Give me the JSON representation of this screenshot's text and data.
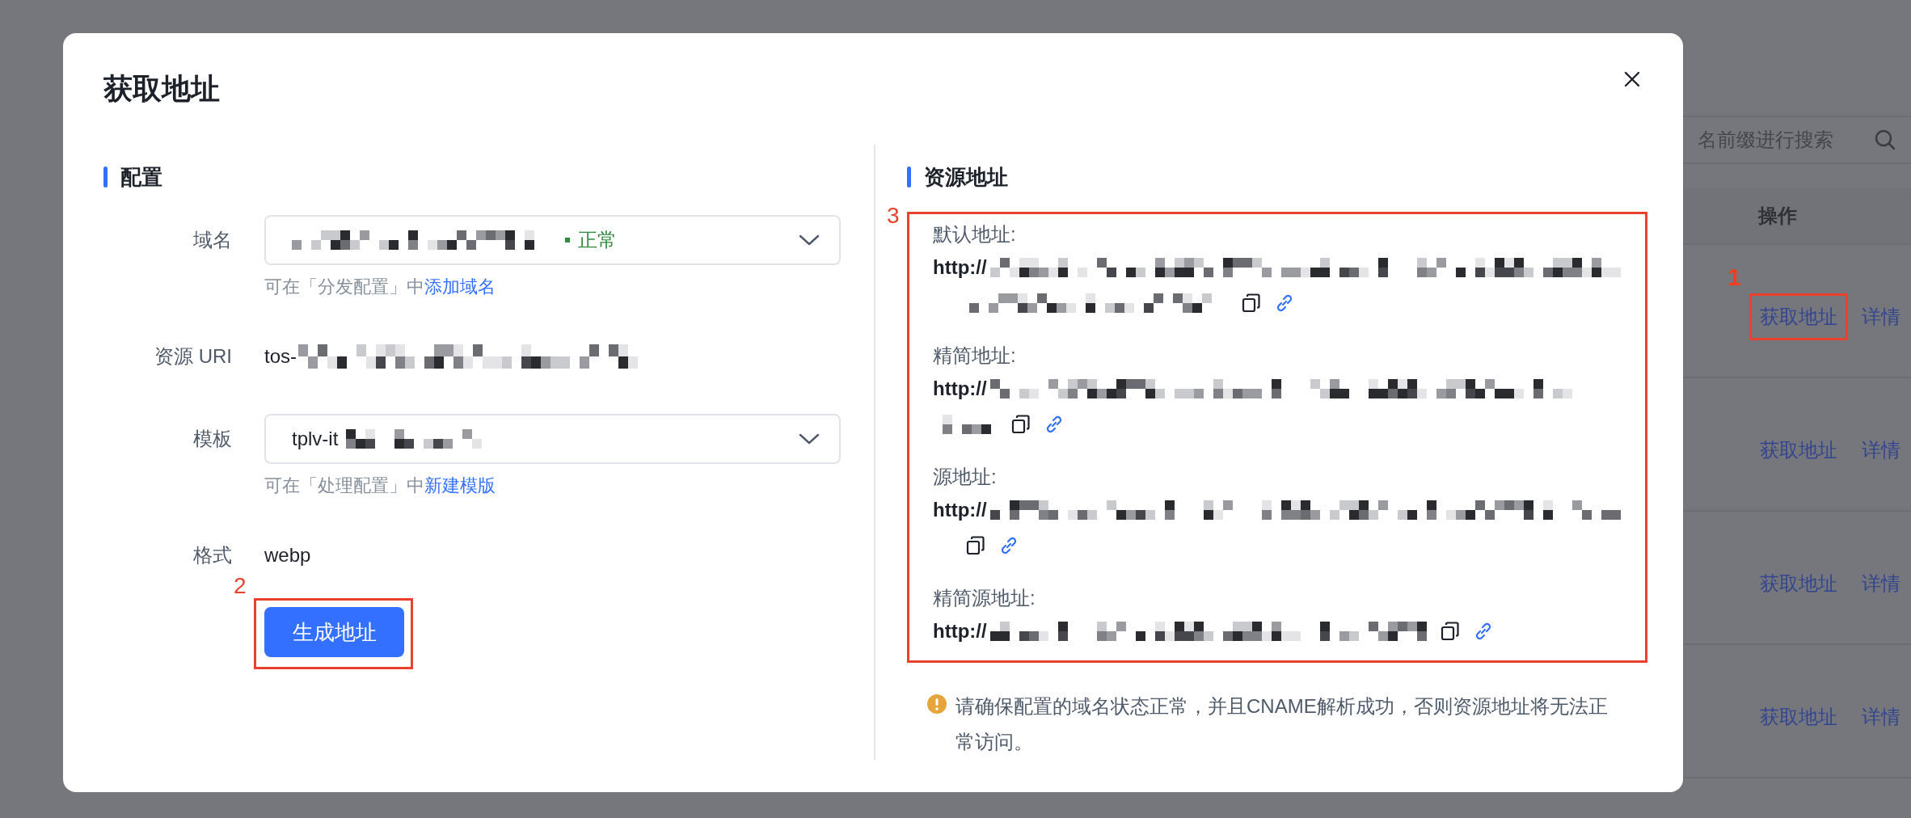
{
  "background_page": {
    "search": {
      "placeholder": "名前缀进行搜索"
    },
    "table": {
      "columns": [
        "操作"
      ],
      "rows": [
        {
          "actions": [
            "获取地址",
            "详情"
          ],
          "annotation": "1"
        },
        {
          "actions": [
            "获取地址",
            "详情"
          ]
        },
        {
          "actions": [
            "获取地址",
            "详情"
          ]
        },
        {
          "actions": [
            "获取地址",
            "详情"
          ]
        }
      ]
    }
  },
  "dialog": {
    "title": "获取地址",
    "config": {
      "heading": "配置",
      "domain": {
        "label": "域名",
        "status": {
          "text": "正常",
          "color": "#2f8a3f"
        },
        "hint": "可在「分发配置」中",
        "hint_link": "添加域名"
      },
      "resource_uri": {
        "label": "资源 URI",
        "value": "tos-"
      },
      "template": {
        "label": "模板",
        "value": "tplv-it",
        "hint": "可在「处理配置」中",
        "hint_link": "新建模版"
      },
      "format": {
        "label": "格式",
        "value": "webp"
      },
      "generate_button": {
        "label": "生成地址",
        "annotation": "2"
      }
    },
    "addresses": {
      "heading": "资源地址",
      "annotation": "3",
      "entries": [
        {
          "label": "默认地址:",
          "prefix": "http://"
        },
        {
          "label": "精简地址:",
          "prefix": "http://"
        },
        {
          "label": "源地址:",
          "prefix": "http://"
        },
        {
          "label": "精简源地址:",
          "prefix": "http://"
        }
      ],
      "note": "请确保配置的域名状态正常，并且CNAME解析成功，否则资源地址将无法正常访问。"
    }
  }
}
